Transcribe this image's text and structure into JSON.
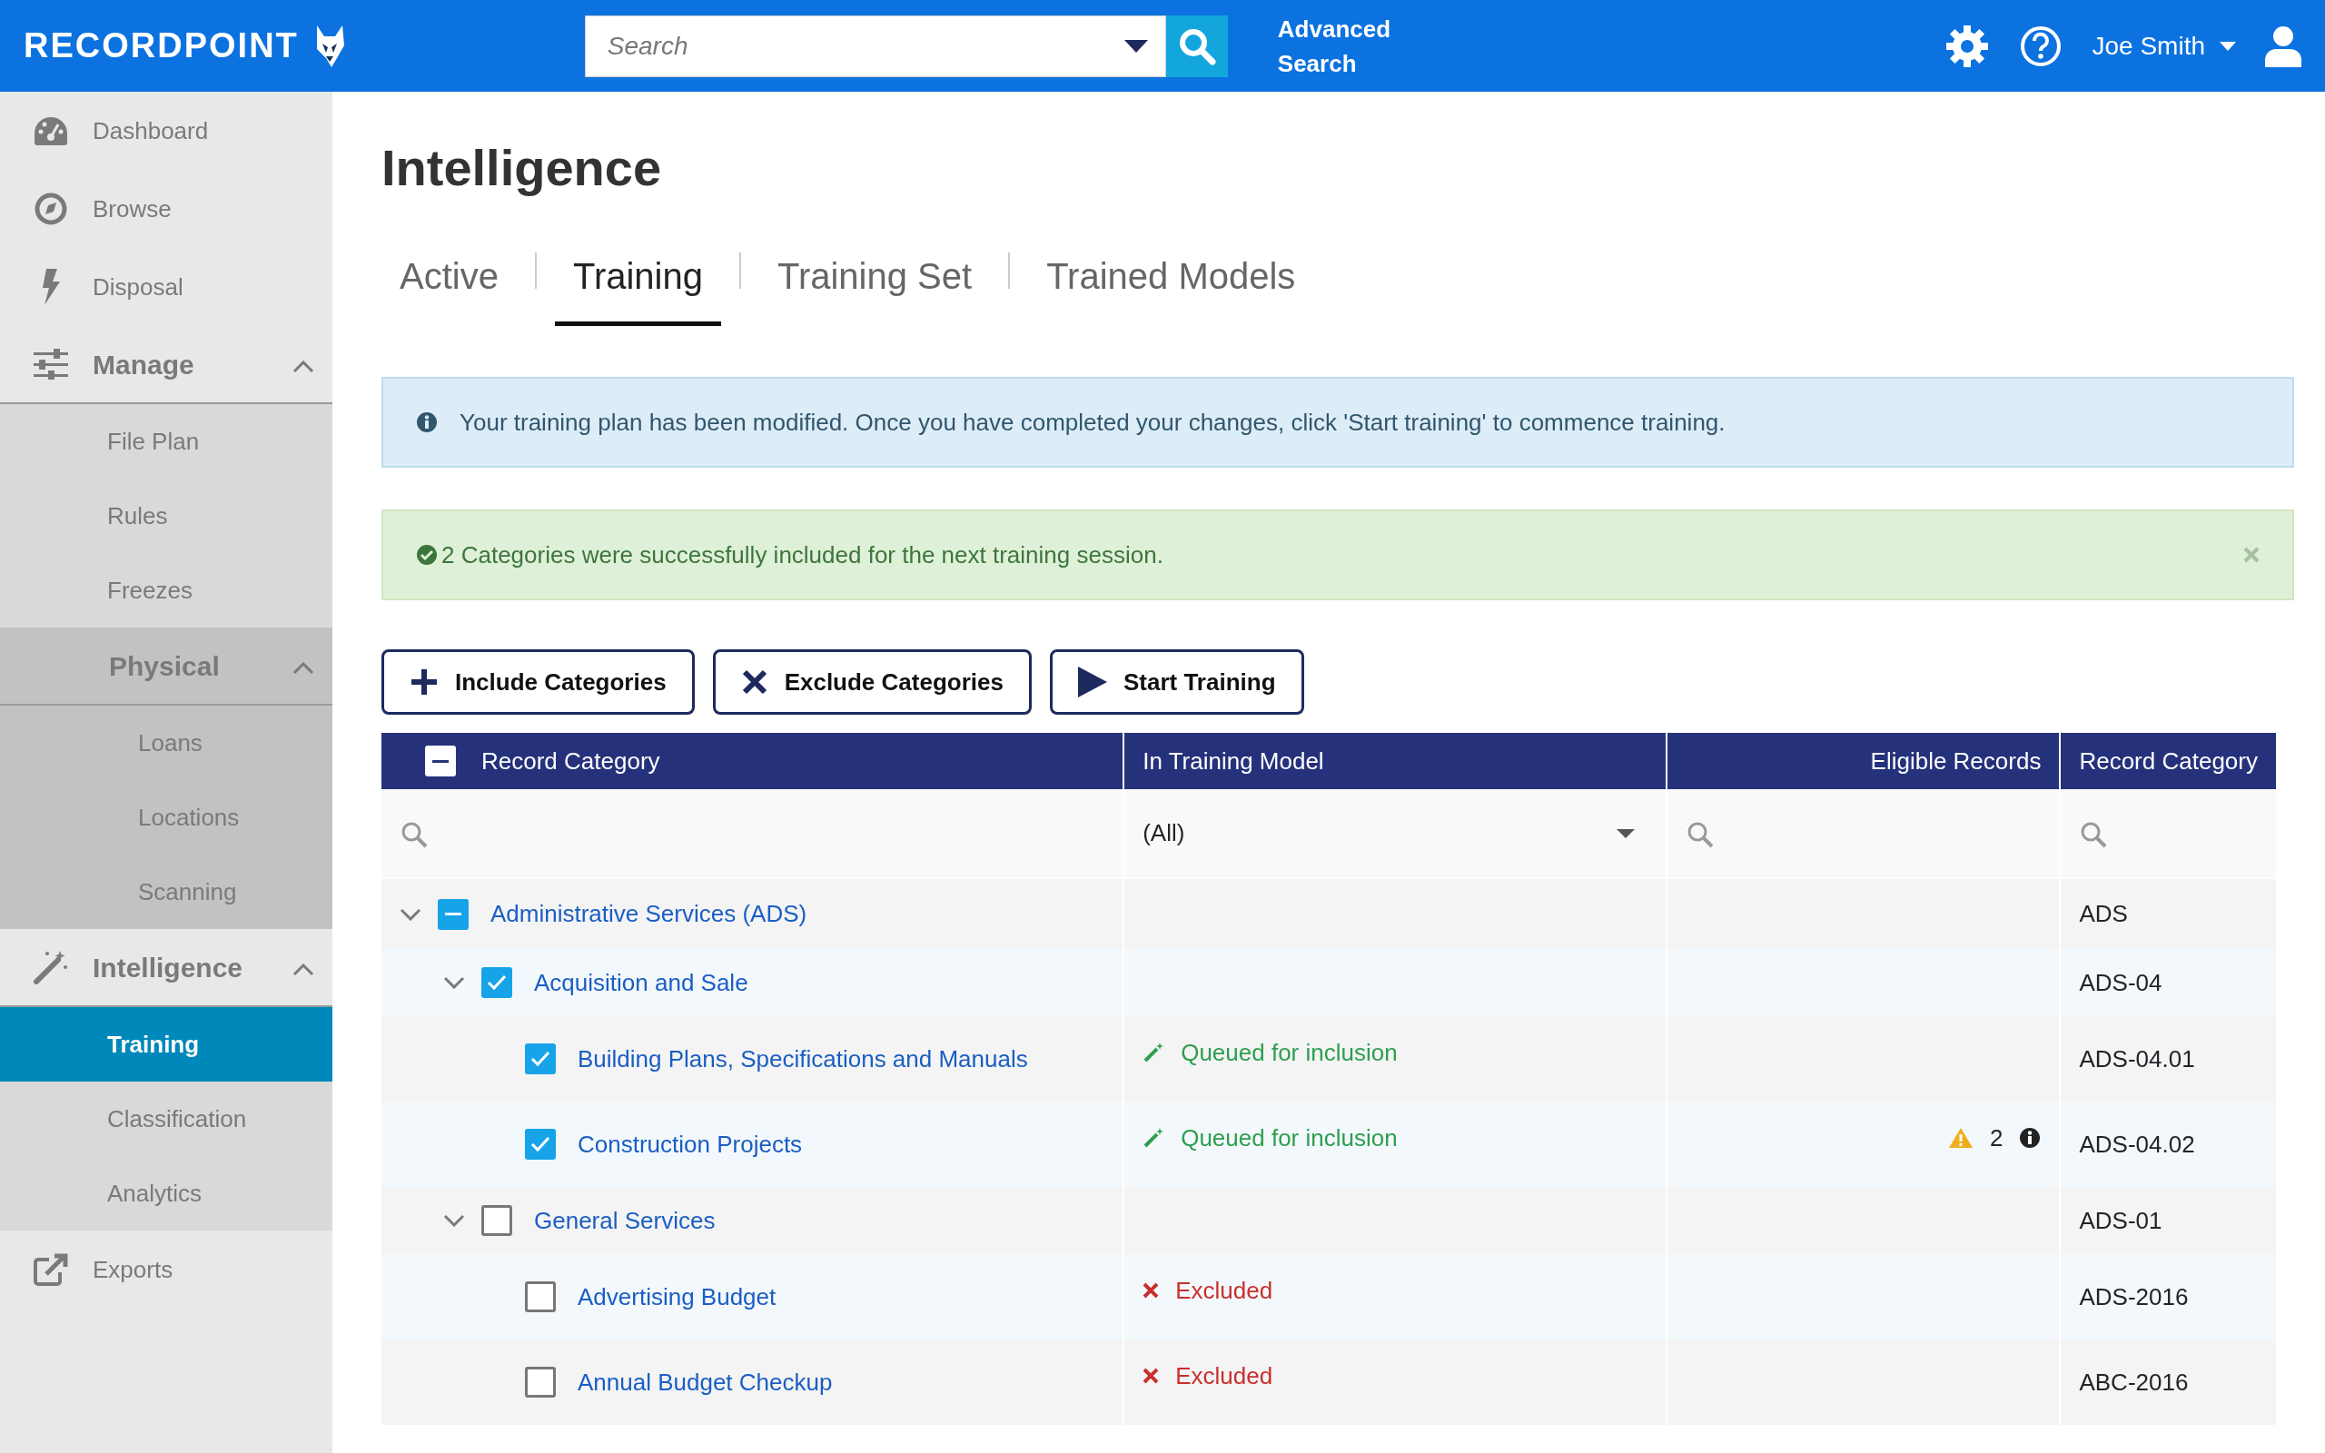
{
  "header": {
    "logo": "RECORDPOINT",
    "search": {
      "placeholder": "Search"
    },
    "advanced_search": "Advanced Search",
    "user": "Joe Smith"
  },
  "sidebar": {
    "items": [
      {
        "kind": "link",
        "label": "Dashboard",
        "selected": false
      },
      {
        "kind": "link",
        "label": "Browse",
        "selected": false
      },
      {
        "kind": "link",
        "label": "Disposal",
        "selected": false
      },
      {
        "kind": "section",
        "label": "Manage",
        "expanded": true,
        "children": [
          {
            "kind": "link",
            "label": "File Plan",
            "selected": false
          },
          {
            "kind": "link",
            "label": "Rules",
            "selected": false
          },
          {
            "kind": "link",
            "label": "Freezes",
            "selected": false
          },
          {
            "kind": "section",
            "label": "Physical",
            "expanded": true,
            "children": [
              {
                "kind": "link",
                "label": "Loans",
                "selected": false
              },
              {
                "kind": "link",
                "label": "Locations",
                "selected": false
              },
              {
                "kind": "link",
                "label": "Scanning",
                "selected": false
              }
            ]
          }
        ]
      },
      {
        "kind": "section",
        "label": "Intelligence",
        "expanded": true,
        "children": [
          {
            "kind": "link",
            "label": "Training",
            "selected": true
          },
          {
            "kind": "link",
            "label": "Classification",
            "selected": false
          },
          {
            "kind": "link",
            "label": "Analytics",
            "selected": false
          }
        ]
      },
      {
        "kind": "link",
        "label": "Exports",
        "selected": false
      }
    ]
  },
  "page": {
    "title": "Intelligence",
    "tabs": [
      {
        "label": "Active",
        "selected": false
      },
      {
        "label": "Training",
        "selected": true
      },
      {
        "label": "Training Set",
        "selected": false
      },
      {
        "label": "Trained Models",
        "selected": false
      }
    ],
    "alerts": [
      {
        "kind": "info",
        "text": "Your training plan has been modified. Once you have completed your changes, click 'Start training' to commence training.",
        "dismissible": false
      },
      {
        "kind": "success",
        "text": "2 Categories were successfully included for the next training session.",
        "dismissible": true
      }
    ],
    "buttons": [
      {
        "kind": "include",
        "label": "Include Categories"
      },
      {
        "kind": "exclude",
        "label": "Exclude Categories"
      },
      {
        "kind": "start",
        "label": "Start Training"
      }
    ]
  },
  "table": {
    "columns": [
      {
        "label": "Record Category",
        "indeterminate": true,
        "filter": {
          "kind": "search"
        }
      },
      {
        "label": "In Training Model",
        "filter": {
          "kind": "select",
          "value": "(All)"
        }
      },
      {
        "label": "Eligible Records",
        "filter": {
          "kind": "search"
        }
      },
      {
        "label": "Record Category",
        "filter": {
          "kind": "search"
        }
      }
    ],
    "rows": [
      {
        "label": "Administrative Services (ADS)",
        "indeterminate": true,
        "expanded": true,
        "code": "ADS",
        "children": [
          {
            "label": "Acquisition and Sale",
            "checked": true,
            "expanded": true,
            "code": "ADS-04",
            "children": [
              {
                "label": "Building Plans, Specifications and Manuals",
                "checked": true,
                "status": {
                  "kind": "queued",
                  "text": "Queued for inclusion"
                },
                "code": "ADS-04.01"
              },
              {
                "label": "Construction Projects",
                "checked": true,
                "status": {
                  "kind": "queued",
                  "text": "Queued for inclusion"
                },
                "eligible": {
                  "warning": true,
                  "count": "2",
                  "info": true
                },
                "code": "ADS-04.02"
              }
            ]
          },
          {
            "label": "General Services",
            "checked": false,
            "expanded": true,
            "code": "ADS-01",
            "children": [
              {
                "label": "Advertising Budget",
                "checked": false,
                "status": {
                  "kind": "excluded",
                  "text": "Excluded"
                },
                "code": "ADS-2016"
              },
              {
                "label": "Annual Budget Checkup",
                "checked": false,
                "status": {
                  "kind": "excluded",
                  "text": "Excluded"
                },
                "code": "ABC-2016"
              }
            ]
          }
        ]
      }
    ]
  }
}
